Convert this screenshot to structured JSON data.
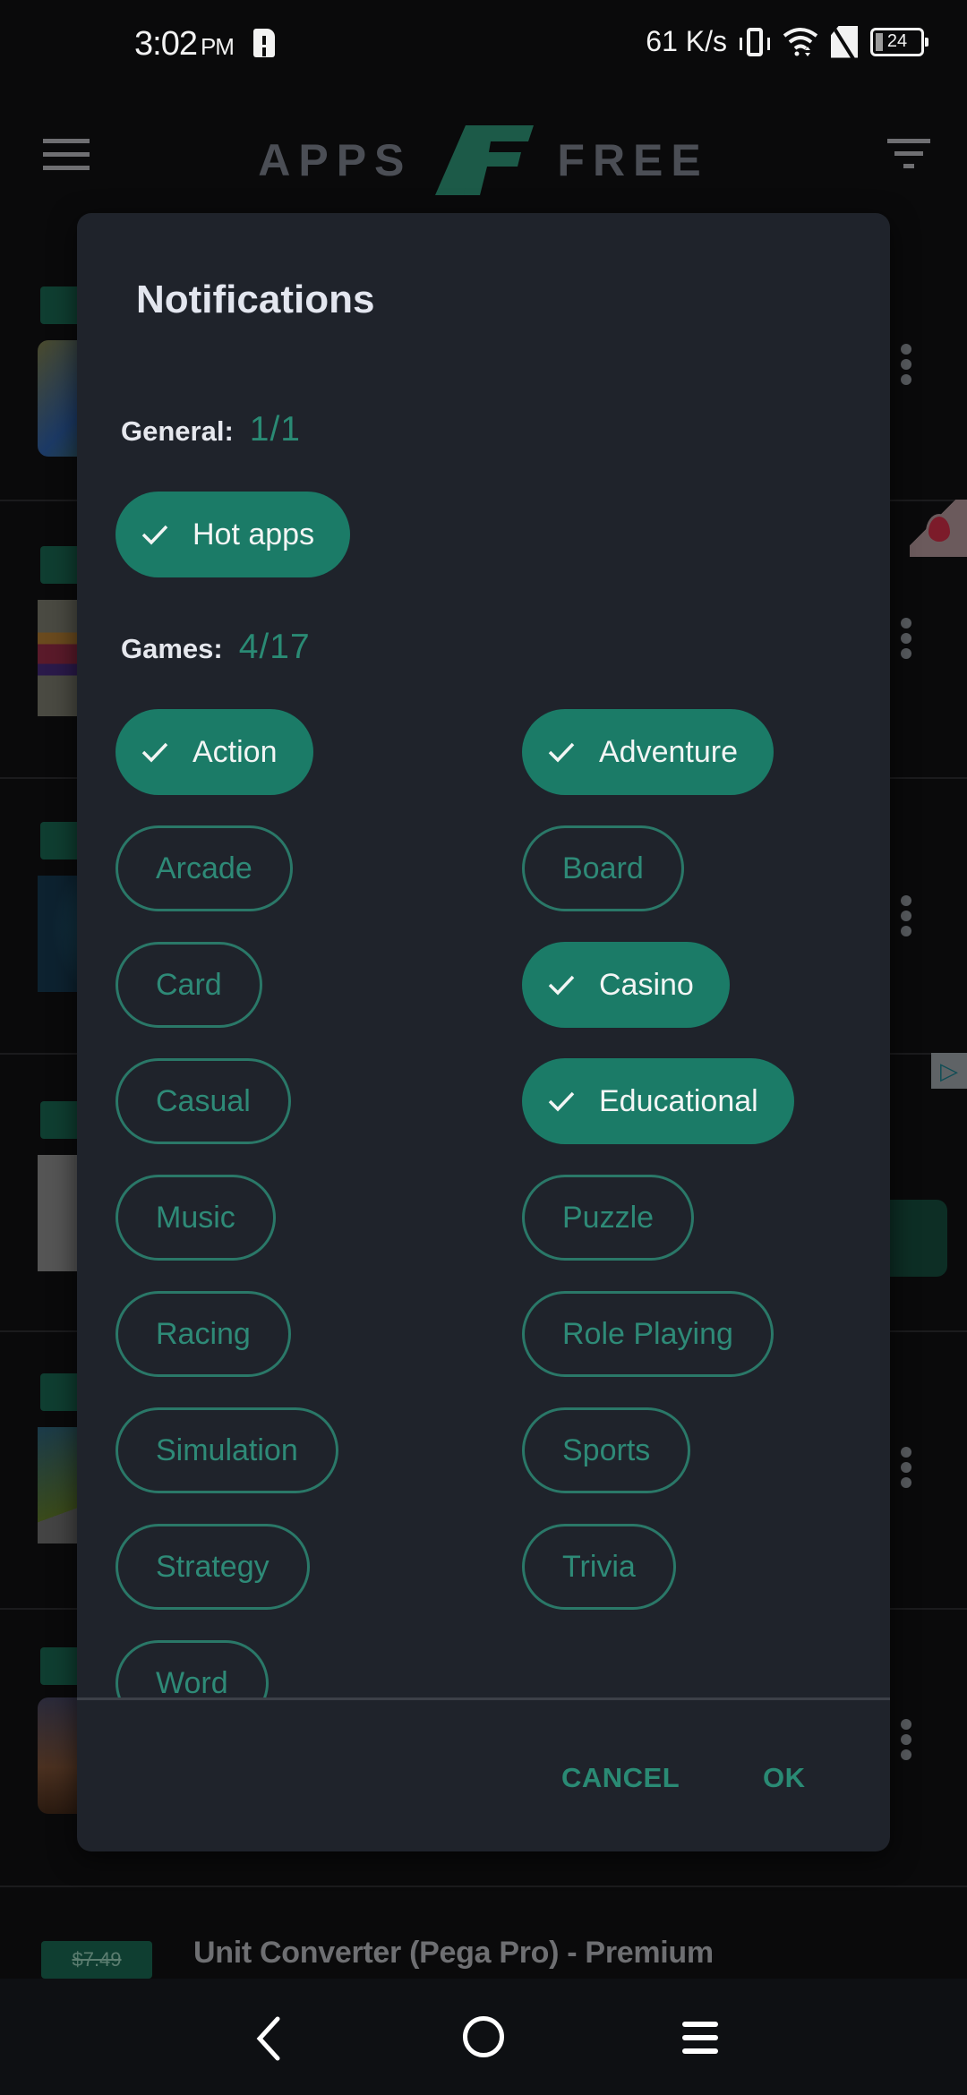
{
  "status_bar": {
    "time": "3:02",
    "ampm": "PM",
    "network_speed": "61 K/s",
    "battery_level": "24",
    "icons": [
      "alert-icon",
      "vibrate-icon",
      "wifi-icon",
      "no-sim-icon",
      "battery-icon"
    ]
  },
  "app_bar": {
    "logo_left": "APPS",
    "logo_right": "FREE",
    "menu_icon": "hamburger-menu-icon",
    "filter_icon": "filter-icon"
  },
  "background_list": {
    "visible_item_title": "Unit Converter (Pega Pro) - Premium",
    "visible_item_price": "$7.49"
  },
  "dialog": {
    "title": "Notifications",
    "sections": [
      {
        "label": "General:",
        "count": "1/1",
        "chips": [
          {
            "label": "Hot apps",
            "selected": true
          }
        ]
      },
      {
        "label": "Games:",
        "count": "4/17",
        "chips": [
          {
            "label": "Action",
            "selected": true
          },
          {
            "label": "Adventure",
            "selected": true
          },
          {
            "label": "Arcade",
            "selected": false
          },
          {
            "label": "Board",
            "selected": false
          },
          {
            "label": "Card",
            "selected": false
          },
          {
            "label": "Casino",
            "selected": true
          },
          {
            "label": "Casual",
            "selected": false
          },
          {
            "label": "Educational",
            "selected": true
          },
          {
            "label": "Music",
            "selected": false
          },
          {
            "label": "Puzzle",
            "selected": false
          },
          {
            "label": "Racing",
            "selected": false
          },
          {
            "label": "Role Playing",
            "selected": false
          },
          {
            "label": "Simulation",
            "selected": false
          },
          {
            "label": "Sports",
            "selected": false
          },
          {
            "label": "Strategy",
            "selected": false
          },
          {
            "label": "Trivia",
            "selected": false
          },
          {
            "label": "Word",
            "selected": false
          }
        ]
      }
    ],
    "cancel_label": "CANCEL",
    "ok_label": "OK"
  },
  "colors": {
    "accent": "#1b7b67",
    "accent_text": "#2a8a74",
    "dialog_bg": "#1f232b",
    "screen_bg": "#0a0a0b"
  },
  "nav_bar": {
    "back_icon": "back-icon",
    "home_icon": "home-icon",
    "recents_icon": "recents-icon"
  }
}
